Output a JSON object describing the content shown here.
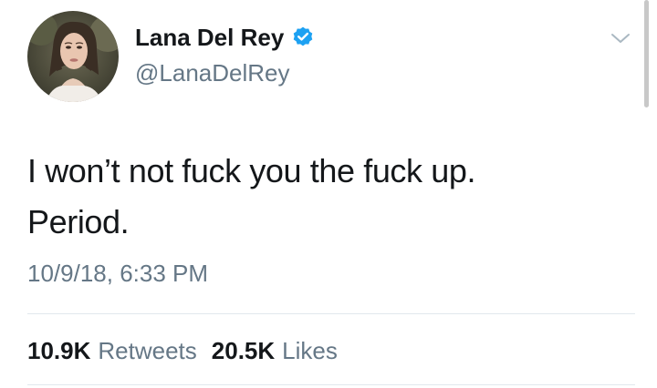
{
  "author": {
    "display_name": "Lana Del Rey",
    "handle": "@LanaDelRey",
    "verified": true,
    "verified_icon": "verified-badge-icon",
    "avatar_icon": "profile-photo"
  },
  "tweet": {
    "text_lines": [
      "I won’t not fuck you the fuck up.",
      "Period."
    ],
    "timestamp": "10/9/18, 6:33 PM"
  },
  "stats": {
    "retweets_count": "10.9K",
    "retweets_label": "Retweets",
    "likes_count": "20.5K",
    "likes_label": "Likes"
  },
  "menu": {
    "icon": "chevron-down-icon"
  },
  "colors": {
    "primary_text": "#14171a",
    "secondary_text": "#657786",
    "verified_blue": "#1da1f2",
    "divider": "#e1e8ed"
  }
}
